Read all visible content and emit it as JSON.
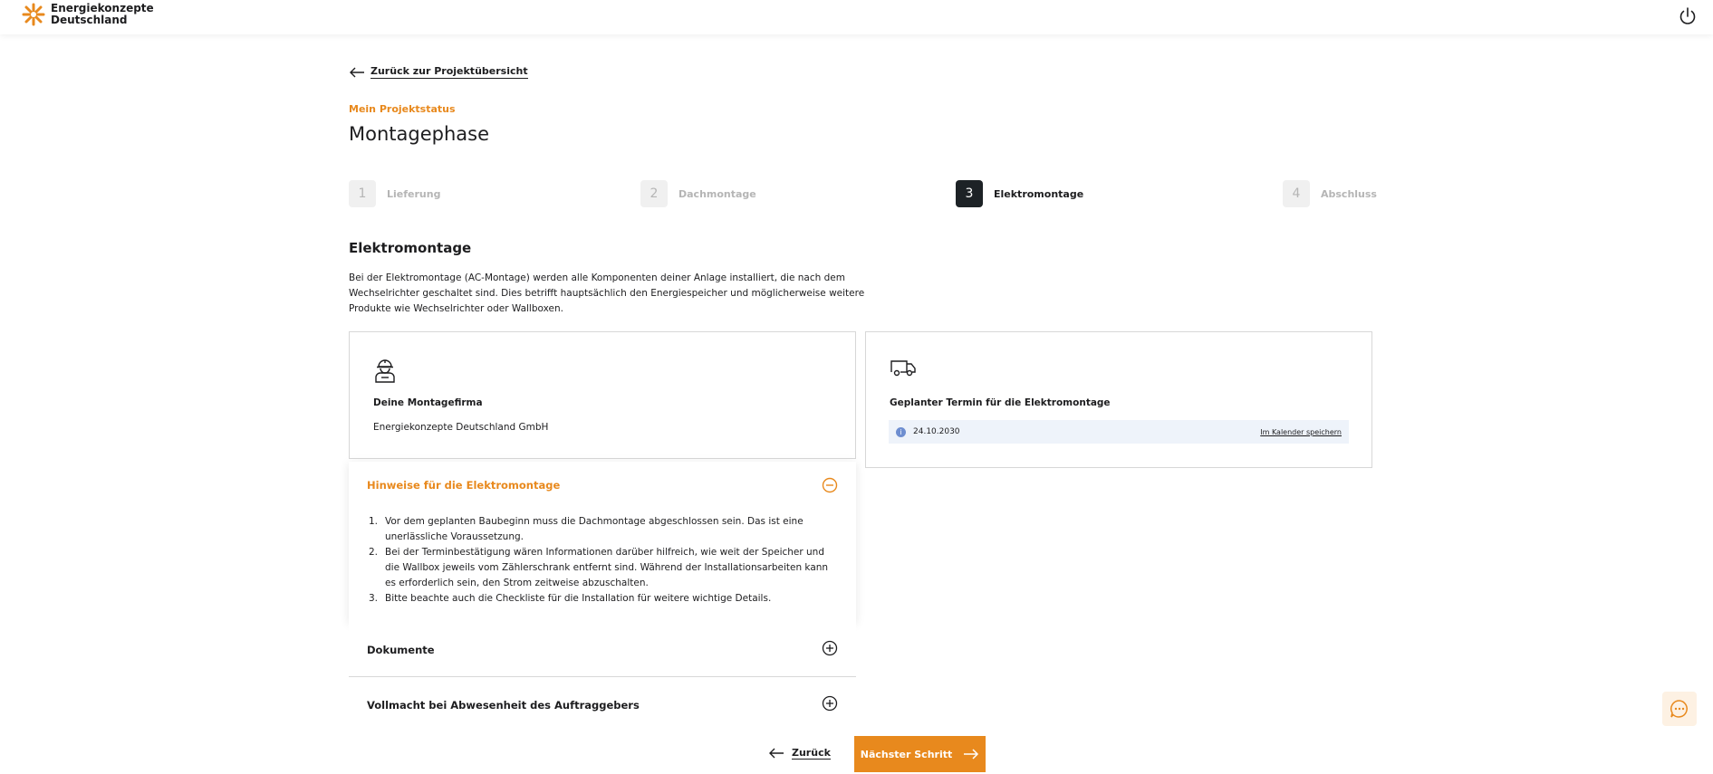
{
  "brand": {
    "name_line1": "Energiekonzepte",
    "name_line2": "Deutschland",
    "accent": "#e8891d",
    "dark": "#1d2226"
  },
  "header": {
    "logo_icon": "sunburst-logo-icon",
    "logout_icon": "power-icon"
  },
  "nav": {
    "back_to_overview": "Zurück zur Projektübersicht"
  },
  "page": {
    "eyebrow": "Mein Projektstatus",
    "title": "Montagephase"
  },
  "steps": [
    {
      "num": "1",
      "label": "Lieferung",
      "active": false
    },
    {
      "num": "2",
      "label": "Dachmontage",
      "active": false
    },
    {
      "num": "3",
      "label": "Elektromontage",
      "active": true
    },
    {
      "num": "4",
      "label": "Abschluss",
      "active": false
    }
  ],
  "section": {
    "title": "Elektromontage",
    "description": "Bei der Elektromontage (AC-Montage) werden alle Komponenten deiner Anlage installiert, die nach dem Wechselrichter geschaltet sind. Dies betrifft hauptsächlich den Energiespeicher und möglicherweise weitere Produkte wie Wechselrichter oder Wallboxen."
  },
  "card_company": {
    "icon": "worker-helmet-icon",
    "title": "Deine Montagefirma",
    "value": "Energiekonzepte Deutschland GmbH"
  },
  "card_appointment": {
    "icon": "delivery-van-icon",
    "title": "Geplanter Termin für die Elektromontage",
    "date": "24.10.2030",
    "calendar_link": "Im Kalender speichern"
  },
  "hints": {
    "title": "Hinweise für die Elektromontage",
    "items": [
      {
        "n": "1.",
        "text": "Vor dem geplanten Baubeginn muss die Dachmontage abgeschlossen sein. Das ist eine unerlässliche Voraussetzung."
      },
      {
        "n": "2.",
        "text": "Bei der Terminbestätigung wären Informationen darüber hilfreich, wie weit der Speicher und die Wallbox jeweils vom Zählerschrank entfernt sind. Während der Installationsarbeiten kann es erforderlich sein, den Strom zeitweise abzuschalten."
      },
      {
        "n": "3.",
        "text": "Bitte beachte auch die Checkliste für die Installation für weitere wichtige Details."
      }
    ]
  },
  "accordions": {
    "documents": "Dokumente",
    "power_of_attorney": "Vollmacht bei Abwesenheit des Auftraggebers"
  },
  "footer": {
    "back": "Zurück",
    "next": "Nächster Schritt"
  }
}
